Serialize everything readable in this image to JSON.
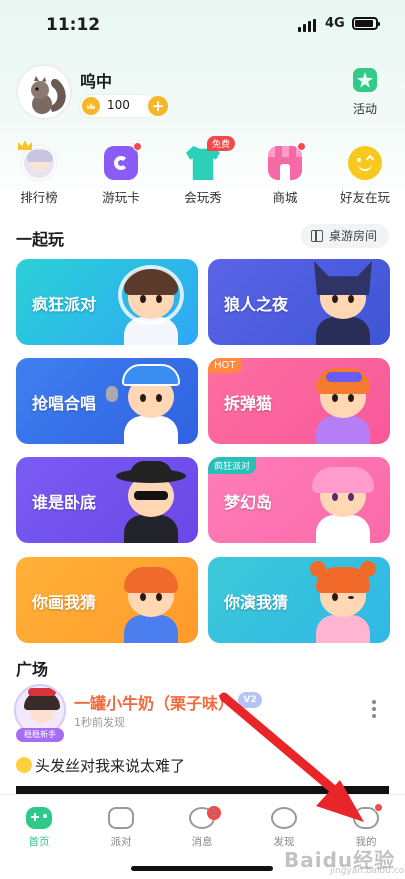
{
  "status_bar": {
    "time": "11:12",
    "network": "4G"
  },
  "profile": {
    "username": "呜中",
    "coins": "100",
    "activity_label": "活动"
  },
  "quick_menu": [
    {
      "label": "排行榜",
      "icon": "ranking-avatar-icon"
    },
    {
      "label": "游玩卡",
      "icon": "play-card-icon"
    },
    {
      "label": "会玩秀",
      "icon": "outfit-icon",
      "badge": "免费"
    },
    {
      "label": "商城",
      "icon": "shop-icon"
    },
    {
      "label": "好友在玩",
      "icon": "friends-icon"
    }
  ],
  "play_together": {
    "title": "一起玩",
    "room_button": "桌游房间",
    "games": [
      {
        "name": "疯狂派对",
        "badge": ""
      },
      {
        "name": "狼人之夜",
        "badge": ""
      },
      {
        "name": "抢唱合唱",
        "badge": ""
      },
      {
        "name": "拆弹猫",
        "badge": "HOT"
      },
      {
        "name": "谁是卧底",
        "badge": ""
      },
      {
        "name": "梦幻岛",
        "badge": "疯狂派对"
      },
      {
        "name": "你画我猜",
        "badge": ""
      },
      {
        "name": "你演我猜",
        "badge": ""
      }
    ]
  },
  "plaza": {
    "title": "广场",
    "post": {
      "avatar_tag": "稳稳新手",
      "author": "一罐小牛奶（栗子味）",
      "level": "V2",
      "time": "1秒前发现",
      "text": "头发丝对我来说太难了"
    }
  },
  "tabbar": [
    {
      "label": "首页",
      "active": true
    },
    {
      "label": "派对",
      "active": false
    },
    {
      "label": "消息",
      "active": false,
      "count": "1"
    },
    {
      "label": "发现",
      "active": false
    },
    {
      "label": "我的",
      "active": false
    }
  ],
  "watermark": {
    "main": "Baidu经验",
    "sub": "jingyan.baidu.com"
  },
  "colors": {
    "accent": "#2cc987",
    "alert": "#f04a4a",
    "coin": "#f7b52a",
    "author": "#f06a3c"
  }
}
